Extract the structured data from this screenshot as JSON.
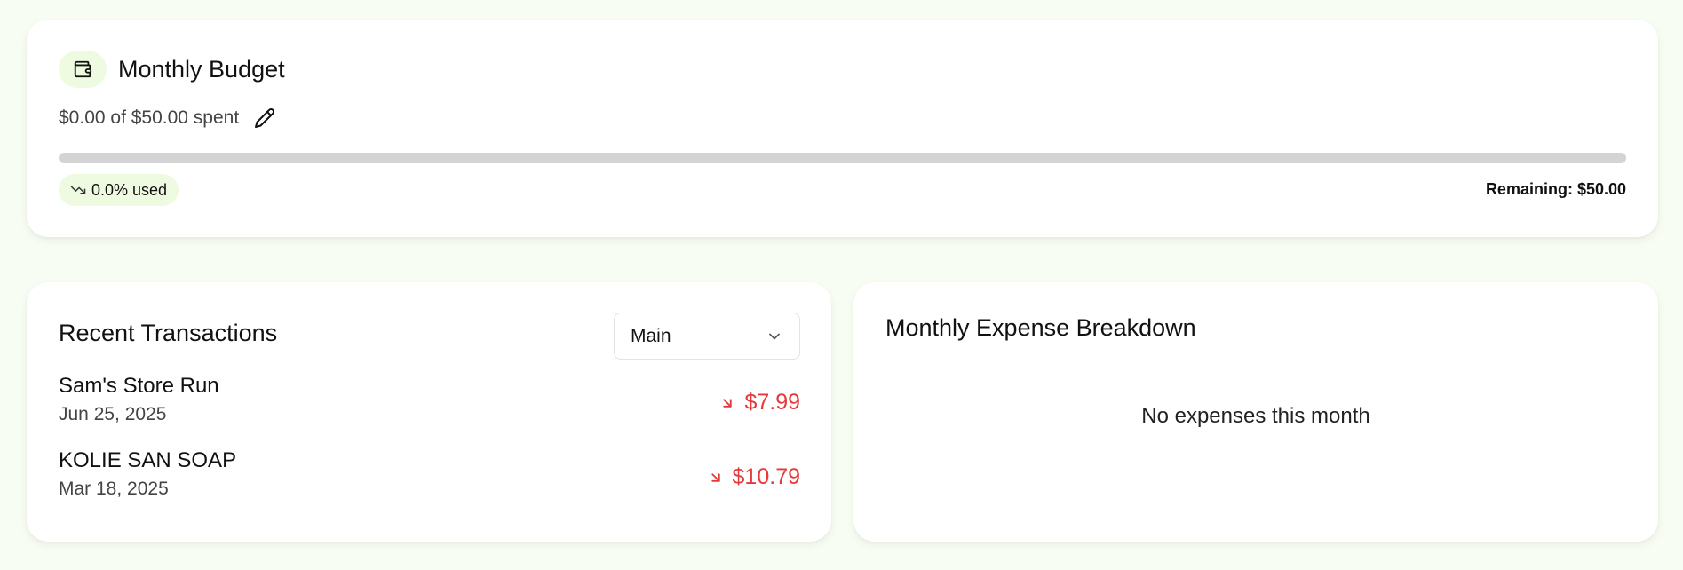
{
  "budget": {
    "title": "Monthly Budget",
    "wallet_icon": "wallet-icon",
    "spent_text": "$0.00 of $50.00 spent",
    "edit_icon": "pencil-icon",
    "progress_fraction": 0.0,
    "used_text": "0.0% used",
    "used_icon": "trend-down-icon",
    "remaining_text": "Remaining: $50.00",
    "colors": {
      "pill_bg": "#eefbe0",
      "track": "#d4d4d4"
    }
  },
  "transactions": {
    "title": "Recent Transactions",
    "account_select": {
      "value": "Main",
      "icon": "chevron-down-icon"
    },
    "items": [
      {
        "name": "Sam's Store Run",
        "date": "Jun 25, 2025",
        "amount": "$7.99",
        "icon": "arrow-down-right-icon"
      },
      {
        "name": "KOLIE SAN SOAP",
        "date": "Mar 18, 2025",
        "amount": "$10.79",
        "icon": "arrow-down-right-icon"
      }
    ],
    "colors": {
      "expense": "#e5393b"
    }
  },
  "breakdown": {
    "title": "Monthly Expense Breakdown",
    "empty_message": "No expenses this month"
  }
}
